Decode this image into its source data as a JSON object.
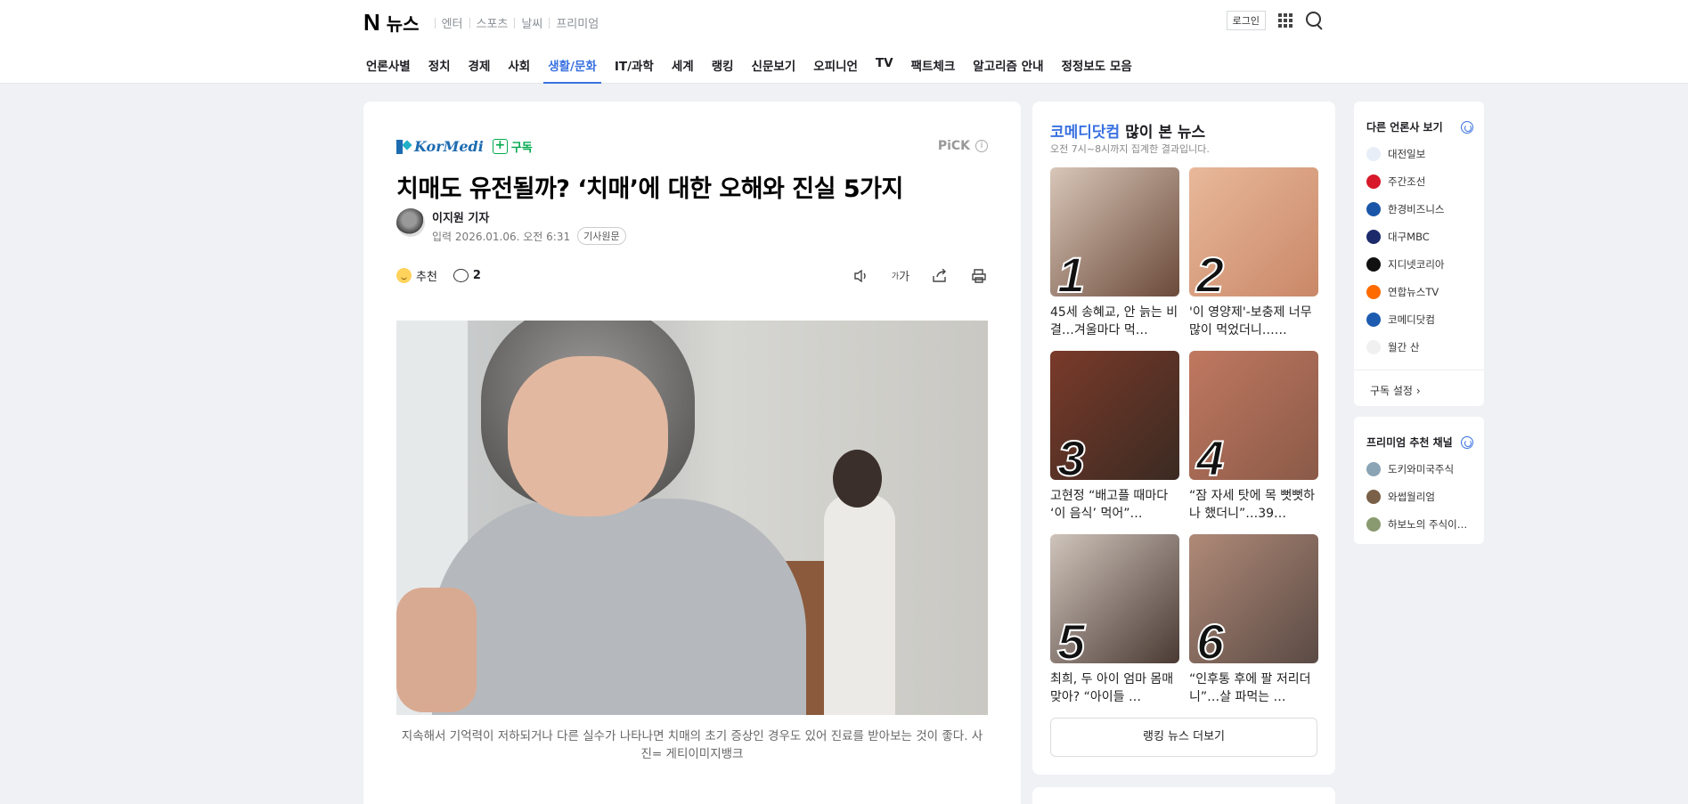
{
  "header": {
    "brand_letter": "N",
    "brand_name": "뉴스",
    "services": [
      "엔터",
      "스포츠",
      "날씨",
      "프리미엄"
    ],
    "login": "로그인"
  },
  "nav": {
    "items": [
      "언론사별",
      "정치",
      "경제",
      "사회",
      "생활/문화",
      "IT/과학",
      "세계",
      "랭킹",
      "신문보기",
      "오피니언",
      "TV",
      "팩트체크",
      "알고리즘 안내",
      "정정보도 모음"
    ],
    "active_index": 4
  },
  "article": {
    "press_name": "KorMedi",
    "subscribe": "구독",
    "pick": "PiCK",
    "title": "치매도 유전될까? ‘치매’에 대한 오해와 진실 5가지",
    "reporter": "이지원 기자",
    "date_label": "입력",
    "date": "2026.01.06. 오전 6:31",
    "original": "기사원문",
    "recommend": "추천",
    "comment_count": "2",
    "font_size_icon": "가",
    "caption": "지속해서 기억력이 저하되거나 다른 실수가 나타나면 치매의 초기 증상인 경우도 있어 진료를 받아보는 것이 좋다. 사진= 게티이미지뱅크"
  },
  "ranking": {
    "press": "코메디닷컴",
    "title_suffix": " 많이 본 뉴스",
    "subtitle": "오전 7시~8시까지 집계한 결과입니다.",
    "items": [
      {
        "rank": "1",
        "text": "45세 송혜교, 안 늙는 비결…겨울마다 먹…",
        "colors": [
          "#d8c6b8",
          "#6b4a3a"
        ]
      },
      {
        "rank": "2",
        "text": "'이 영양제'-보충제 너무 많이 먹었더니……",
        "colors": [
          "#e8b89a",
          "#c98868"
        ]
      },
      {
        "rank": "3",
        "text": "고현정 “배고플 때마다 ‘이 음식’ 먹어”…",
        "colors": [
          "#7a3a2a",
          "#3a2a22"
        ]
      },
      {
        "rank": "4",
        "text": "“잠 자세 탓에 목 뻣뻣하나 했더니”…39…",
        "colors": [
          "#c07860",
          "#8a5a48"
        ]
      },
      {
        "rank": "5",
        "text": "최희, 두 아이 엄마 몸매 맞아? “아이들 …",
        "colors": [
          "#cfc4bb",
          "#4a3a33"
        ]
      },
      {
        "rank": "6",
        "text": "“인후통 후에 팔 저리더니”…살 파먹는 …",
        "colors": [
          "#b08a78",
          "#5a4a44"
        ]
      }
    ],
    "more": "랭킹 뉴스 더보기"
  },
  "other_press": {
    "title": "다른 언론사 보기",
    "items": [
      {
        "name": "대전일보",
        "color": "#e7eef7"
      },
      {
        "name": "주간조선",
        "color": "#d7192a"
      },
      {
        "name": "한경비즈니스",
        "color": "#1a56a8"
      },
      {
        "name": "대구MBC",
        "color": "#1c2a6b"
      },
      {
        "name": "지디넷코리아",
        "color": "#111111"
      },
      {
        "name": "연합뉴스TV",
        "color": "#ff6a00"
      },
      {
        "name": "코메디닷컴",
        "color": "#1d5bb0"
      },
      {
        "name": "월간 산",
        "color": "#f0f0f0"
      }
    ],
    "settings": "구독 설정"
  },
  "premium": {
    "title": "프리미엄 추천 채널",
    "items": [
      {
        "name": "도키와미국주식",
        "color": "#8aa3b5"
      },
      {
        "name": "와썹월리엄",
        "color": "#7a6048"
      },
      {
        "name": "하보노의 주식이…",
        "color": "#8a9a70"
      }
    ]
  }
}
